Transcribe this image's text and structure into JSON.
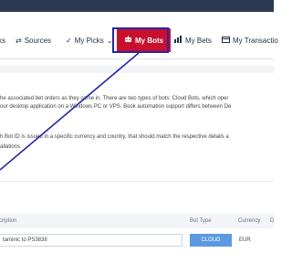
{
  "nav": {
    "items": [
      {
        "label": "ks",
        "icon": ""
      },
      {
        "label": "Sources",
        "icon": "arrows-icon"
      },
      {
        "label": "My Picks",
        "icon": "check-icon",
        "dropdown": true
      },
      {
        "label": "My Bots",
        "icon": "robot-icon",
        "active": true
      },
      {
        "label": "My Bets",
        "icon": "chart-icon"
      },
      {
        "label": "My Transactio",
        "icon": "card-icon"
      }
    ],
    "accent_color": "#c8102e",
    "highlight_color": "#2626a8"
  },
  "content": {
    "line1": "he associated bet orders as they come in. There are two types of bots: Cloud Bots, which oper",
    "line2": "our desktop application on a Windows PC or VPS. Book automation support differs between De",
    "line3": "h Bot ID is issued in a specific currency and country, that should match the respective details a",
    "line4": "allations."
  },
  "table": {
    "headers": {
      "description": "cription",
      "bot_type": "Bot Type",
      "currency": "Currency",
      "extra": "D"
    },
    "row": {
      "description": "taminic to PS3838",
      "bot_type": "CLOUD",
      "currency": "EUR"
    }
  }
}
